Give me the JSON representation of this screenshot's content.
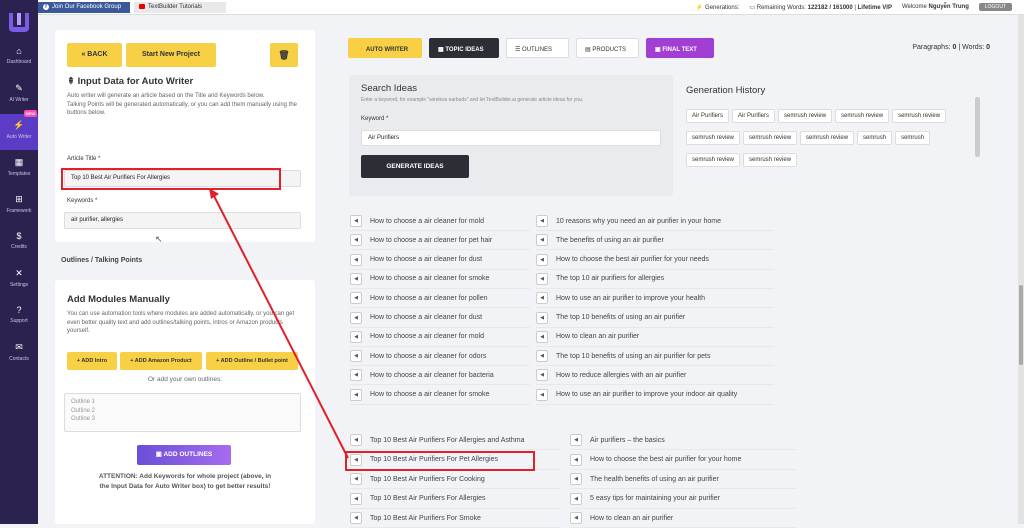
{
  "topbar": {
    "facebook_label": "Join Our Facebook Group",
    "tutorials_label": "TextBuilder Tutorials",
    "generations_label": "Generations:",
    "remaining_label": "Remaining Words:",
    "remaining_value": "122182 / 161000",
    "plan": "Lifetime VIP",
    "welcome": "Welcome",
    "user": "Nguyễn Trung",
    "logout": "LOGOUT"
  },
  "sidebar": {
    "items": [
      {
        "label": "Dashboard",
        "icon": "⌂"
      },
      {
        "label": "AI Writer",
        "icon": "✎"
      },
      {
        "label": "Auto Writer",
        "icon": "⚡",
        "badge": "NEW"
      },
      {
        "label": "Templates",
        "icon": "▦"
      },
      {
        "label": "Framework",
        "icon": "⊞"
      },
      {
        "label": "Credits",
        "icon": "$"
      },
      {
        "label": "Settings",
        "icon": "✕"
      },
      {
        "label": "Support",
        "icon": "?"
      },
      {
        "label": "Contacts",
        "icon": "✉"
      }
    ]
  },
  "left": {
    "back": "« BACK",
    "start_new": "Start New Project",
    "trash_icon": "trash-icon",
    "title": "Input Data for Auto Writer",
    "desc1": "Auto writer will generate an article based on the Title and Keywords below.",
    "desc2": "Talking Points will be generated automatically, or you can add them manually using the buttons below.",
    "article_title_label": "Article Title *",
    "article_title_value": "Top 10 Best Air Purifiers For Allergies",
    "keywords_label": "Keywords *",
    "keywords_value": "air purifier, allergies",
    "outlines_heading": "Outlines / Talking Points",
    "add_modules_title": "Add Modules Manually",
    "add_modules_desc": "You can use automation tools where modules are added automatically, or you can get even better quality text and add outlines/talking points, intros or Amazon products yourself.",
    "add_intro": "+ ADD Intro",
    "add_amazon": "+ ADD Amazon Product",
    "add_outline": "+ ADD Outline / Bullet point",
    "or_add": "Or add your own outlines:",
    "outline_placeholder": "Outline 1\nOutline 2\nOutline 3",
    "add_outlines_btn": "ADD OUTLINES",
    "attention": "ATTENTION: Add Keywords for whole project (above, in the Input Data for Auto Writer box) to get better results!"
  },
  "tabs": [
    "AUTO WRITER",
    "TOPIC IDEAS",
    "OUTLINES",
    "PRODUCTS",
    "FINAL TEXT"
  ],
  "counter": {
    "paragraphs_label": "Paragraphs:",
    "paragraphs": "0",
    "words_label": "| Words:",
    "words": "0"
  },
  "search": {
    "title": "Search Ideas",
    "hint": "Enter a keyword, for example \"wireless earbuds\" and let TextBuilder.ai generate article ideas for you.",
    "keyword_label": "Keyword *",
    "keyword_value": "Air Purifiers",
    "generate": "GENERATE IDEAS"
  },
  "history": {
    "title": "Generation History",
    "chips": [
      "Air Purifiers",
      "Air Purifiers",
      "semrush review",
      "semrush review",
      "semrush review",
      "semrush review",
      "semrush review",
      "semrush review",
      "semrush",
      "semrush",
      "semrush review",
      "semrush review"
    ]
  },
  "ideas_left": [
    "How to choose a air cleaner for mold",
    "How to choose a air cleaner for pet hair",
    "How to choose a air cleaner for dust",
    "How to choose a air cleaner for smoke",
    "How to choose a air cleaner for pollen",
    "How to choose a air cleaner for dust",
    "How to choose a air cleaner for mold",
    "How to choose a air cleaner for odors",
    "How to choose a air cleaner for bacteria",
    "How to choose a air cleaner for smoke"
  ],
  "ideas_right": [
    "10 reasons why you need an air purifier in your home",
    "The benefits of using an air purifier",
    "How to choose the best air purifier for your needs",
    "The top 10 air purifiers for allergies",
    "How to use an air purifier to improve your health",
    "The top 10 benefits of using an air purifier",
    "How to clean an air purifier",
    "The top 10 benefits of using an air purifier for pets",
    "How to reduce allergies with an air purifier",
    "How to use an air purifier to improve your indoor air quality"
  ],
  "ideas2_left": [
    "Top 10 Best Air Purifiers For Allergies and Asthma",
    "Top 10 Best Air Purifiers For Pet Allergies",
    "Top 10 Best Air Purifiers For Cooking",
    "Top 10 Best Air Purifiers For Allergies",
    "Top 10 Best Air Purifiers For Smoke"
  ],
  "ideas2_right": [
    "Air purifiers – the basics",
    "How to choose the best air purifier for your home",
    "The health benefits of using an air purifier",
    "5 easy tips for maintaining your air purifier",
    "How to clean an air purifier"
  ],
  "colors": {
    "accent_yellow": "#f7d046",
    "sidebar": "#2b2250",
    "highlight_red": "#e0202a",
    "purple": "#7b4fd6"
  }
}
